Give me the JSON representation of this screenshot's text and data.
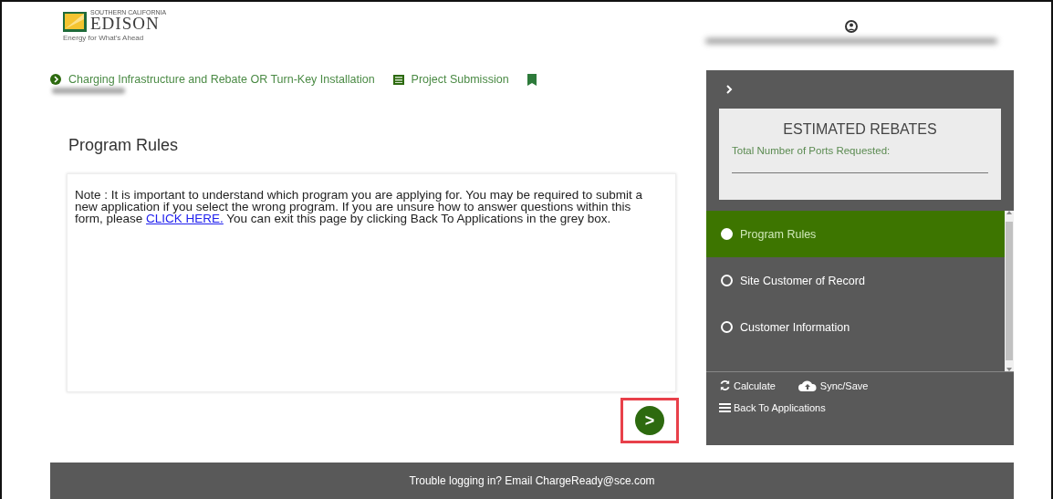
{
  "header": {
    "logo": {
      "tagline_small": "SOUTHERN CALIFORNIA",
      "wordmark": "EDISON",
      "slogan": "Energy for What's Ahead"
    }
  },
  "breadcrumb": [
    {
      "label": "Charging Infrastructure and Rebate OR Turn-Key Installation",
      "kind": "circle"
    },
    {
      "label": "Project Submission",
      "kind": "form"
    },
    {
      "kind": "bookmark"
    }
  ],
  "main": {
    "title": "Program Rules",
    "note": "Note : It is important to understand which program you are applying for. You may be required to submit a new application if you select the wrong program. If you are unsure how to answer questions within this form, please ",
    "link": "CLICK HERE.",
    "note_end": " You can exit this page by clicking Back To Applications in the grey box.",
    "next_button": ">"
  },
  "sidebar": {
    "estimate": {
      "title": "ESTIMATED REBATES",
      "label": "Total Number of Ports Requested:"
    },
    "steps": [
      {
        "label": "Program Rules",
        "selected": true
      },
      {
        "label": "Site Customer of Record",
        "selected": false
      },
      {
        "label": "Customer Information",
        "selected": false
      }
    ],
    "actions": [
      {
        "label": "Calculate",
        "kind": "calculate"
      },
      {
        "label": "Sync/Save",
        "kind": "sync"
      },
      {
        "label": "Back To Applications",
        "kind": "back"
      }
    ]
  },
  "footer": {
    "text": "Trouble logging in? Email ChargeReady@sce.com"
  }
}
